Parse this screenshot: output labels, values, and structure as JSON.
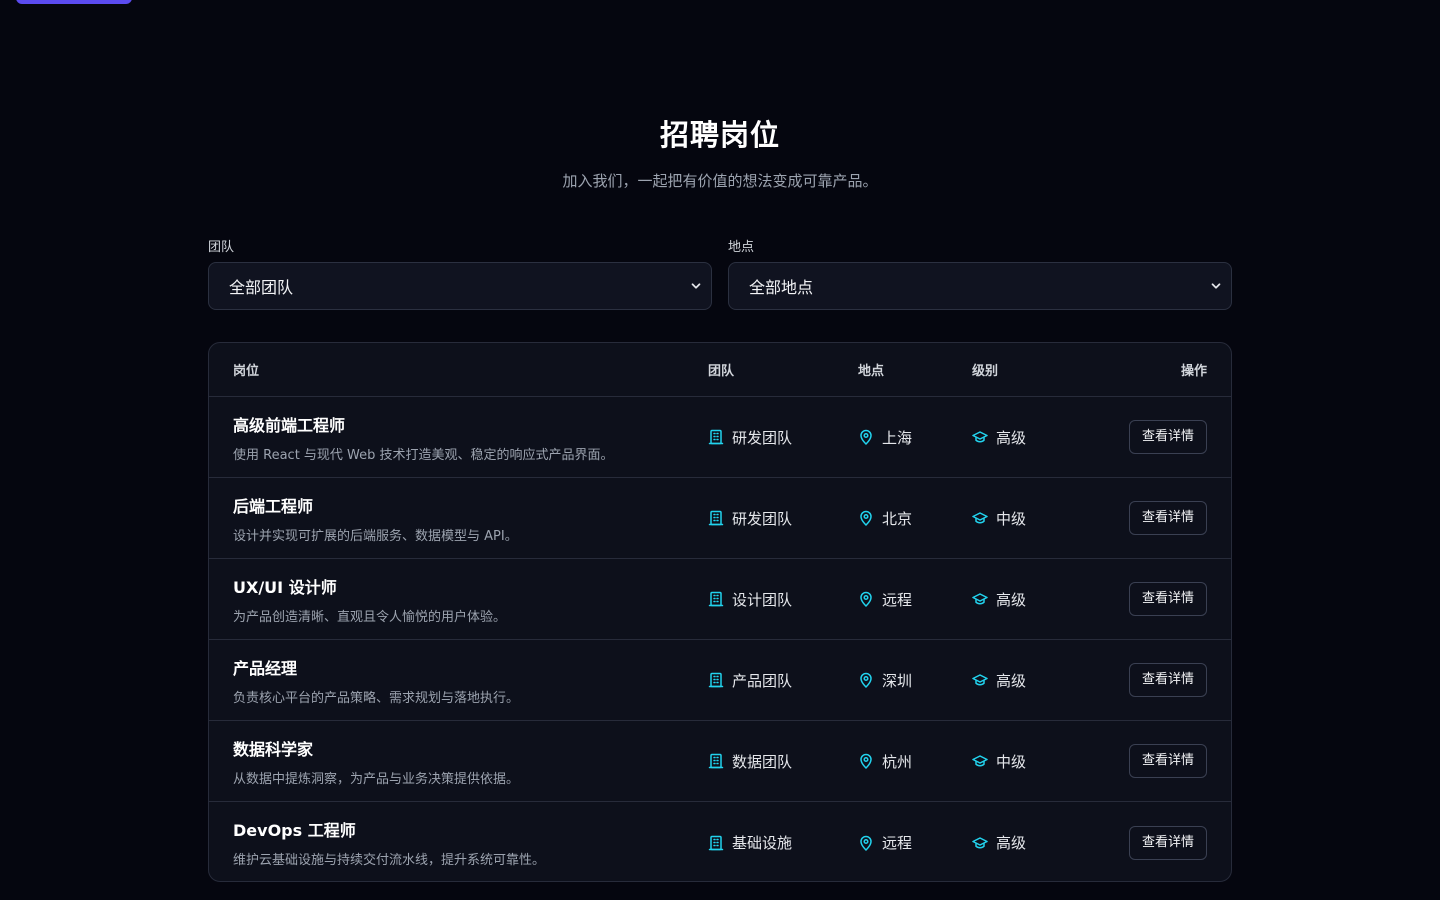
{
  "header": {
    "title": "招聘岗位",
    "subtitle": "加入我们，一起把有价值的想法变成可靠产品。"
  },
  "filters": {
    "team": {
      "label": "团队",
      "value": "全部团队"
    },
    "location": {
      "label": "地点",
      "value": "全部地点"
    }
  },
  "table": {
    "columns": [
      "岗位",
      "团队",
      "地点",
      "级别",
      "操作"
    ],
    "rows": [
      {
        "title": "高级前端工程师",
        "desc": "使用 React 与现代 Web 技术打造美观、稳定的响应式产品界面。",
        "team": "研发团队",
        "location": "上海",
        "level": "高级",
        "action": "查看详情"
      },
      {
        "title": "后端工程师",
        "desc": "设计并实现可扩展的后端服务、数据模型与 API。",
        "team": "研发团队",
        "location": "北京",
        "level": "中级",
        "action": "查看详情"
      },
      {
        "title": "UX/UI 设计师",
        "desc": "为产品创造清晰、直观且令人愉悦的用户体验。",
        "team": "设计团队",
        "location": "远程",
        "level": "高级",
        "action": "查看详情"
      },
      {
        "title": "产品经理",
        "desc": "负责核心平台的产品策略、需求规划与落地执行。",
        "team": "产品团队",
        "location": "深圳",
        "level": "高级",
        "action": "查看详情"
      },
      {
        "title": "数据科学家",
        "desc": "从数据中提炼洞察，为产品与业务决策提供依据。",
        "team": "数据团队",
        "location": "杭州",
        "level": "中级",
        "action": "查看详情"
      },
      {
        "title": "DevOps 工程师",
        "desc": "维护云基础设施与持续交付流水线，提升系统可靠性。",
        "team": "基础设施",
        "location": "远程",
        "level": "高级",
        "action": "查看详情"
      }
    ]
  },
  "icons": {
    "team": "building-icon",
    "location": "map-pin-icon",
    "level": "graduation-cap-icon"
  },
  "colors": {
    "accent": "#5b4bf0",
    "icon": "#22d3ee",
    "background": "#05060f"
  }
}
